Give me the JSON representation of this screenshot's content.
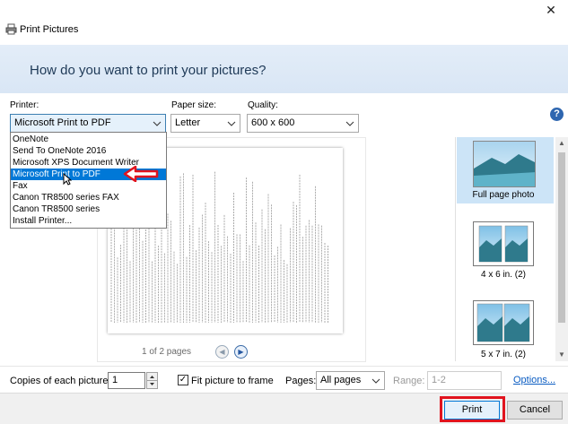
{
  "window": {
    "title": "Print Pictures",
    "close_glyph": "✕",
    "icon": "printer-icon"
  },
  "banner": {
    "question": "How do you want to print your pictures?"
  },
  "settings": {
    "printer_label": "Printer:",
    "printer_value": "Microsoft Print to PDF",
    "paper_size_label": "Paper size:",
    "paper_size_value": "Letter",
    "quality_label": "Quality:",
    "quality_value": "600 x 600",
    "help_glyph": "?"
  },
  "printer_dropdown": {
    "items": [
      "OneNote",
      "Send To OneNote 2016",
      "Microsoft XPS Document Writer",
      "Microsoft Print to PDF",
      "Fax",
      "Canon TR8500 series FAX",
      "Canon TR8500 series",
      "Install Printer..."
    ],
    "selected_index": 3
  },
  "preview": {
    "page_count": "1 of 2 pages",
    "prev_glyph": "◀",
    "next_glyph": "▶"
  },
  "layouts": {
    "items": [
      {
        "label": "Full page photo",
        "selected": true
      },
      {
        "label": "4 x 6 in. (2)",
        "selected": false
      },
      {
        "label": "5 x 7 in. (2)",
        "selected": false
      }
    ]
  },
  "options_bar": {
    "copies_label": "Copies of each picture:",
    "copies_value": "1",
    "fit_label": "Fit picture to frame",
    "fit_checked": true,
    "check_glyph": "✓",
    "pages_label": "Pages:",
    "pages_value": "All pages",
    "range_label": "Range:",
    "range_value": "1-2",
    "options_link": "Options..."
  },
  "footer": {
    "print_label": "Print",
    "cancel_label": "Cancel"
  },
  "colors": {
    "banner": "#dbe7f5",
    "selection": "#0078d7",
    "annotation_red": "#e1141e",
    "link": "#0a5cc2"
  }
}
